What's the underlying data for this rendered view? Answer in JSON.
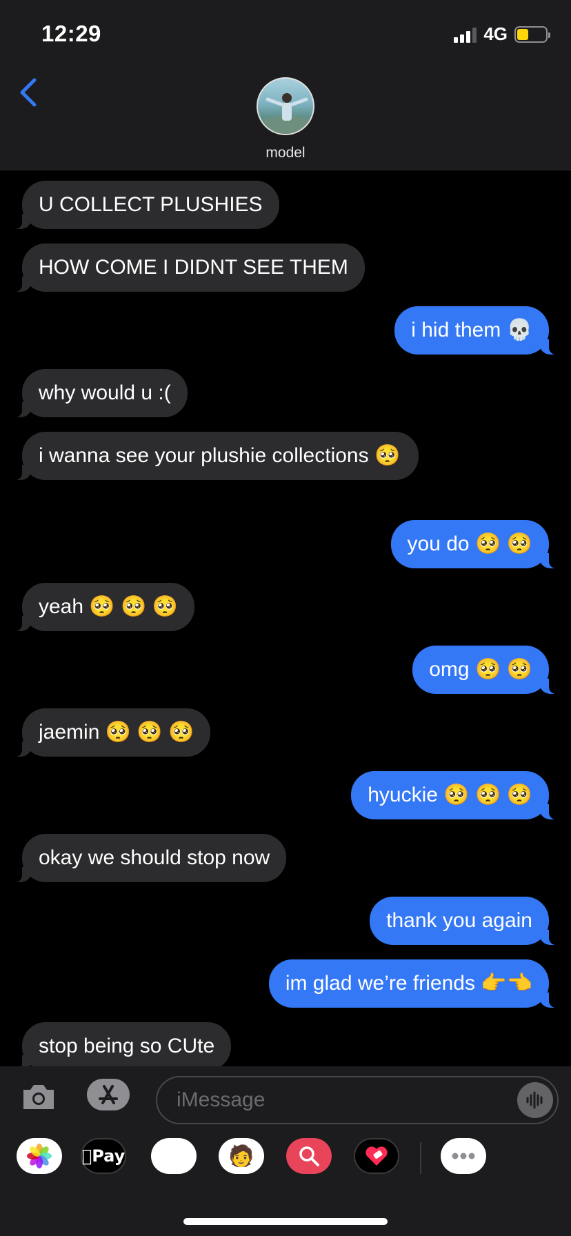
{
  "status_bar": {
    "time": "12:29",
    "network": "4G",
    "battery_level": 0.4
  },
  "header": {
    "contact_name": "model",
    "back_icon": "chevron-left-icon",
    "avatar": "contact-photo"
  },
  "messages": [
    {
      "dir": "in",
      "text": "U COLLECT PLUSHIES"
    },
    {
      "dir": "in",
      "text": "HOW COME I DIDNT SEE THEM"
    },
    {
      "dir": "out",
      "text": "i hid them 💀"
    },
    {
      "dir": "in",
      "text": "why would u :("
    },
    {
      "dir": "in",
      "text": "i wanna see your plushie collections 🥺"
    },
    {
      "dir": "out",
      "text": "you do 🥺 🥺"
    },
    {
      "dir": "in",
      "text": "yeah 🥺 🥺 🥺"
    },
    {
      "dir": "out",
      "text": "omg 🥺 🥺"
    },
    {
      "dir": "in",
      "text": "jaemin 🥺 🥺 🥺"
    },
    {
      "dir": "out",
      "text": "hyuckie 🥺 🥺 🥺"
    },
    {
      "dir": "in",
      "text": "okay we should stop now"
    },
    {
      "dir": "out",
      "text": "thank you again"
    },
    {
      "dir": "out",
      "text": "im glad we’re friends 👉👈"
    },
    {
      "dir": "in",
      "text": "stop being so CUte"
    }
  ],
  "composer": {
    "placeholder": "iMessage",
    "camera_icon": "camera-icon",
    "apps_icon": "app-store-icon",
    "audio_icon": "audio-waveform-icon"
  },
  "app_tray": {
    "items": [
      {
        "name": "photos-app-icon"
      },
      {
        "name": "apple-pay-icon",
        "label": "Pay"
      },
      {
        "name": "animoji-icon"
      },
      {
        "name": "memoji-icon"
      },
      {
        "name": "image-search-icon"
      },
      {
        "name": "digital-touch-icon"
      },
      {
        "name": "more-apps-icon"
      }
    ]
  }
}
